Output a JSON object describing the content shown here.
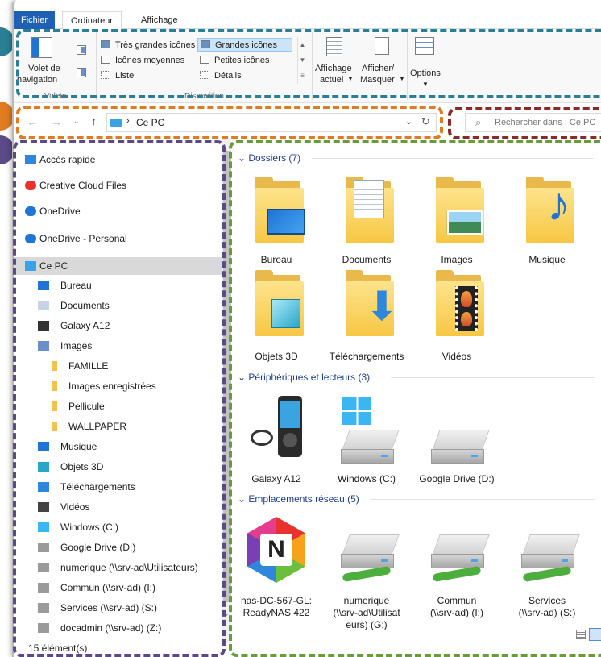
{
  "tabs": {
    "file": "Fichier",
    "computer": "Ordinateur",
    "view": "Affichage"
  },
  "ribbon": {
    "nav_pane_label": "Volet de",
    "nav_pane_label2": "navigation",
    "layout_items": [
      "Très grandes icônes",
      "Grandes icônes",
      "Icônes moyennes",
      "Petites icônes",
      "Liste",
      "Détails"
    ],
    "current_view_label": "Affichage",
    "current_view_label2": "actuel",
    "show_hide_label": "Afficher/",
    "show_hide_label2": "Masquer",
    "options_label": "Options",
    "group_panes": "Volets",
    "group_layout": "Disposition"
  },
  "address": {
    "path": "Ce PC",
    "search_placeholder": "Rechercher dans : Ce PC"
  },
  "nav": {
    "items": [
      {
        "label": "Accès rapide",
        "icon": "star-icon"
      },
      {
        "label": "Creative Cloud Files",
        "icon": "creative-cloud-icon"
      },
      {
        "label": "OneDrive",
        "icon": "cloud-icon"
      },
      {
        "label": "OneDrive - Personal",
        "icon": "cloud-icon"
      },
      {
        "label": "Ce PC",
        "icon": "computer-icon"
      },
      {
        "label": "Bureau",
        "icon": "desktop-icon"
      },
      {
        "label": "Documents",
        "icon": "document-icon"
      },
      {
        "label": "Galaxy A12",
        "icon": "phone-icon"
      },
      {
        "label": "Images",
        "icon": "image-icon"
      },
      {
        "label": "FAMILLE",
        "icon": "folder-icon"
      },
      {
        "label": "Images enregistrées",
        "icon": "folder-icon"
      },
      {
        "label": "Pellicule",
        "icon": "folder-icon"
      },
      {
        "label": "WALLPAPER",
        "icon": "folder-icon"
      },
      {
        "label": "Musique",
        "icon": "music-icon"
      },
      {
        "label": "Objets 3D",
        "icon": "cube-icon"
      },
      {
        "label": "Téléchargements",
        "icon": "download-icon"
      },
      {
        "label": "Vidéos",
        "icon": "video-icon"
      },
      {
        "label": "Windows (C:)",
        "icon": "windows-drive-icon"
      },
      {
        "label": "Google Drive (D:)",
        "icon": "drive-icon"
      },
      {
        "label": "numerique (\\\\srv-ad\\Utilisateurs)",
        "icon": "network-drive-icon"
      },
      {
        "label": "Commun (\\\\srv-ad) (I:)",
        "icon": "network-drive-icon"
      },
      {
        "label": "Services (\\\\srv-ad) (S:)",
        "icon": "network-drive-icon"
      },
      {
        "label": "docadmin (\\\\srv-ad) (Z:)",
        "icon": "network-drive-icon"
      }
    ]
  },
  "status": {
    "count": "15 élément(s)"
  },
  "content": {
    "folders_header": "Dossiers (7)",
    "folders": [
      "Bureau",
      "Documents",
      "Images",
      "Musique",
      "Objets 3D",
      "Téléchargements",
      "Vidéos"
    ],
    "devices_header": "Périphériques et lecteurs (3)",
    "devices": [
      "Galaxy A12",
      "Windows (C:)",
      "Google Drive (D:)"
    ],
    "network_header": "Emplacements réseau (5)",
    "network": [
      {
        "line1": "nas-DC-567-GL:",
        "line2": "ReadyNAS 422",
        "line3": ""
      },
      {
        "line1": "numerique",
        "line2": "(\\\\srv-ad\\Utilisat",
        "line3": "eurs) (G:)"
      },
      {
        "line1": "Commun",
        "line2": "(\\\\srv-ad) (I:)",
        "line3": ""
      },
      {
        "line1": "Services",
        "line2": "(\\\\srv-ad) (S:)",
        "line3": ""
      }
    ]
  },
  "colors": {
    "ribbon_box": "#2a7f94",
    "address_box": "#e07b22",
    "search_box": "#8a2a2a",
    "nav_box": "#5b4a86",
    "content_box": "#6a9b3a",
    "file_tab": "#1f5fb4"
  }
}
